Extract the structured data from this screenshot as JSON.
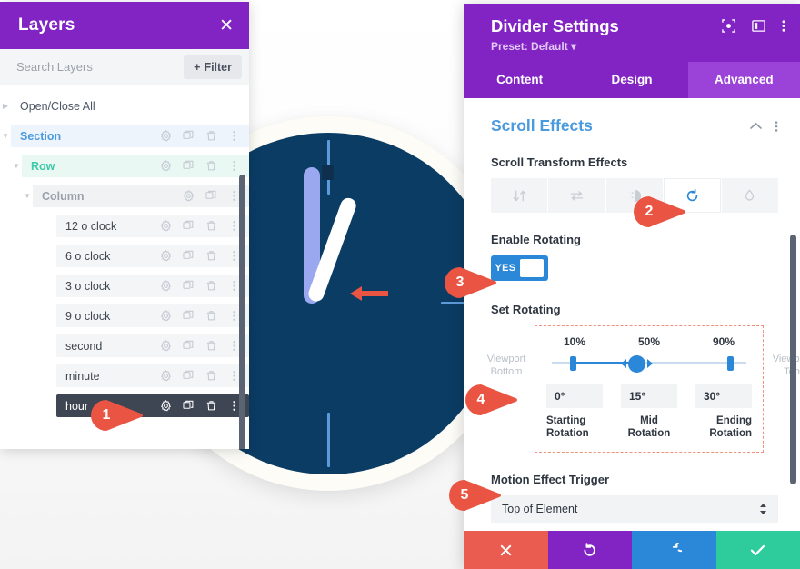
{
  "layers_panel": {
    "title": "Layers",
    "close_icon": "close-icon",
    "search_placeholder": "Search Layers",
    "search_value": "",
    "filter_label": "Filter",
    "filter_plus": "+",
    "open_close_all": "Open/Close All",
    "tree": [
      {
        "label": "Section",
        "type": "section",
        "indent": 1,
        "caret": "down",
        "actions": [
          "gear-icon",
          "duplicate-icon",
          "trash-icon",
          "kebab-icon"
        ]
      },
      {
        "label": "Row",
        "type": "row",
        "indent": 2,
        "caret": "down",
        "actions": [
          "gear-icon",
          "duplicate-icon",
          "trash-icon",
          "kebab-icon"
        ]
      },
      {
        "label": "Column",
        "type": "column",
        "indent": 3,
        "caret": "down",
        "actions": [
          "gear-icon",
          "duplicate-icon",
          "kebab-icon"
        ]
      },
      {
        "label": "12 o clock",
        "type": "module",
        "indent": 4,
        "caret": "none",
        "actions": [
          "gear-icon",
          "duplicate-icon",
          "trash-icon",
          "kebab-icon"
        ]
      },
      {
        "label": "6 o clock",
        "type": "module",
        "indent": 4,
        "caret": "none",
        "actions": [
          "gear-icon",
          "duplicate-icon",
          "trash-icon",
          "kebab-icon"
        ]
      },
      {
        "label": "3 o clock",
        "type": "module",
        "indent": 4,
        "caret": "none",
        "actions": [
          "gear-icon",
          "duplicate-icon",
          "trash-icon",
          "kebab-icon"
        ]
      },
      {
        "label": "9 o clock",
        "type": "module",
        "indent": 4,
        "caret": "none",
        "actions": [
          "gear-icon",
          "duplicate-icon",
          "trash-icon",
          "kebab-icon"
        ]
      },
      {
        "label": "second",
        "type": "module",
        "indent": 4,
        "caret": "none",
        "actions": [
          "gear-icon",
          "duplicate-icon",
          "trash-icon",
          "kebab-icon"
        ]
      },
      {
        "label": "minute",
        "type": "module",
        "indent": 4,
        "caret": "none",
        "actions": [
          "gear-icon",
          "duplicate-icon",
          "trash-icon",
          "kebab-icon"
        ]
      },
      {
        "label": "hour",
        "type": "module",
        "indent": 4,
        "caret": "none",
        "selected": true,
        "actions": [
          "gear-icon",
          "duplicate-icon",
          "trash-icon",
          "kebab-icon"
        ]
      }
    ]
  },
  "settings_panel": {
    "title": "Divider Settings",
    "preset": "Preset: Default",
    "header_icons": [
      "focus-icon",
      "layout-panel-icon",
      "kebab-icon"
    ],
    "tabs": [
      {
        "label": "Content",
        "active": false
      },
      {
        "label": "Design",
        "active": false
      },
      {
        "label": "Advanced",
        "active": true
      }
    ],
    "section": {
      "title": "Scroll Effects",
      "collapse_icon": "chevron-up-icon",
      "menu_icon": "kebab-icon"
    },
    "transform": {
      "label": "Scroll Transform Effects",
      "buttons": [
        {
          "icon": "vertical-motion-icon",
          "active": false
        },
        {
          "icon": "horizontal-motion-icon",
          "active": false
        },
        {
          "icon": "fade-icon",
          "active": false
        },
        {
          "icon": "rotate-icon",
          "active": true
        },
        {
          "icon": "blur-drop-icon",
          "active": false
        }
      ]
    },
    "enable_rotating": {
      "label": "Enable Rotating",
      "toggle_text": "YES",
      "value": true
    },
    "set_rotating": {
      "label": "Set Rotating",
      "viewport_bottom": "Viewport\nBottom",
      "viewport_bottom_line1": "Viewport",
      "viewport_bottom_line2": "Bottom",
      "viewport_top_line1": "Viewport",
      "viewport_top_line2": "Top",
      "percents": [
        "10%",
        "50%",
        "90%"
      ],
      "degrees": [
        "0°",
        "15°",
        "30°"
      ],
      "captions": [
        {
          "line1": "Starting",
          "line2": "Rotation"
        },
        {
          "line1": "Mid",
          "line2": "Rotation"
        },
        {
          "line1": "Ending",
          "line2": "Rotation"
        }
      ]
    },
    "motion_trigger": {
      "label": "Motion Effect Trigger",
      "value": "Top of Element",
      "chevron_icon": "updown-arrows-icon"
    },
    "footer": [
      {
        "name": "cancel-button",
        "icon": "x-icon",
        "color": "#eb5c50"
      },
      {
        "name": "undo-button",
        "icon": "undo-icon",
        "color": "#8223c4"
      },
      {
        "name": "redo-button",
        "icon": "redo-icon",
        "color": "#2b87d7"
      },
      {
        "name": "save-button",
        "icon": "check-icon",
        "color": "#2ecc9c"
      }
    ]
  },
  "callouts": [
    {
      "num": "1"
    },
    {
      "num": "2"
    },
    {
      "num": "3"
    },
    {
      "num": "4"
    },
    {
      "num": "5"
    }
  ],
  "canvas": {
    "clock_face_color": "#0b3c64",
    "clock_ring_color": "#fdfcf7",
    "minute_hand_color": "#9aa8ef",
    "hour_hand_color": "#ffffff",
    "marker_color": "#5e9bdc",
    "arrow_icon": "left-arrow-icon"
  }
}
